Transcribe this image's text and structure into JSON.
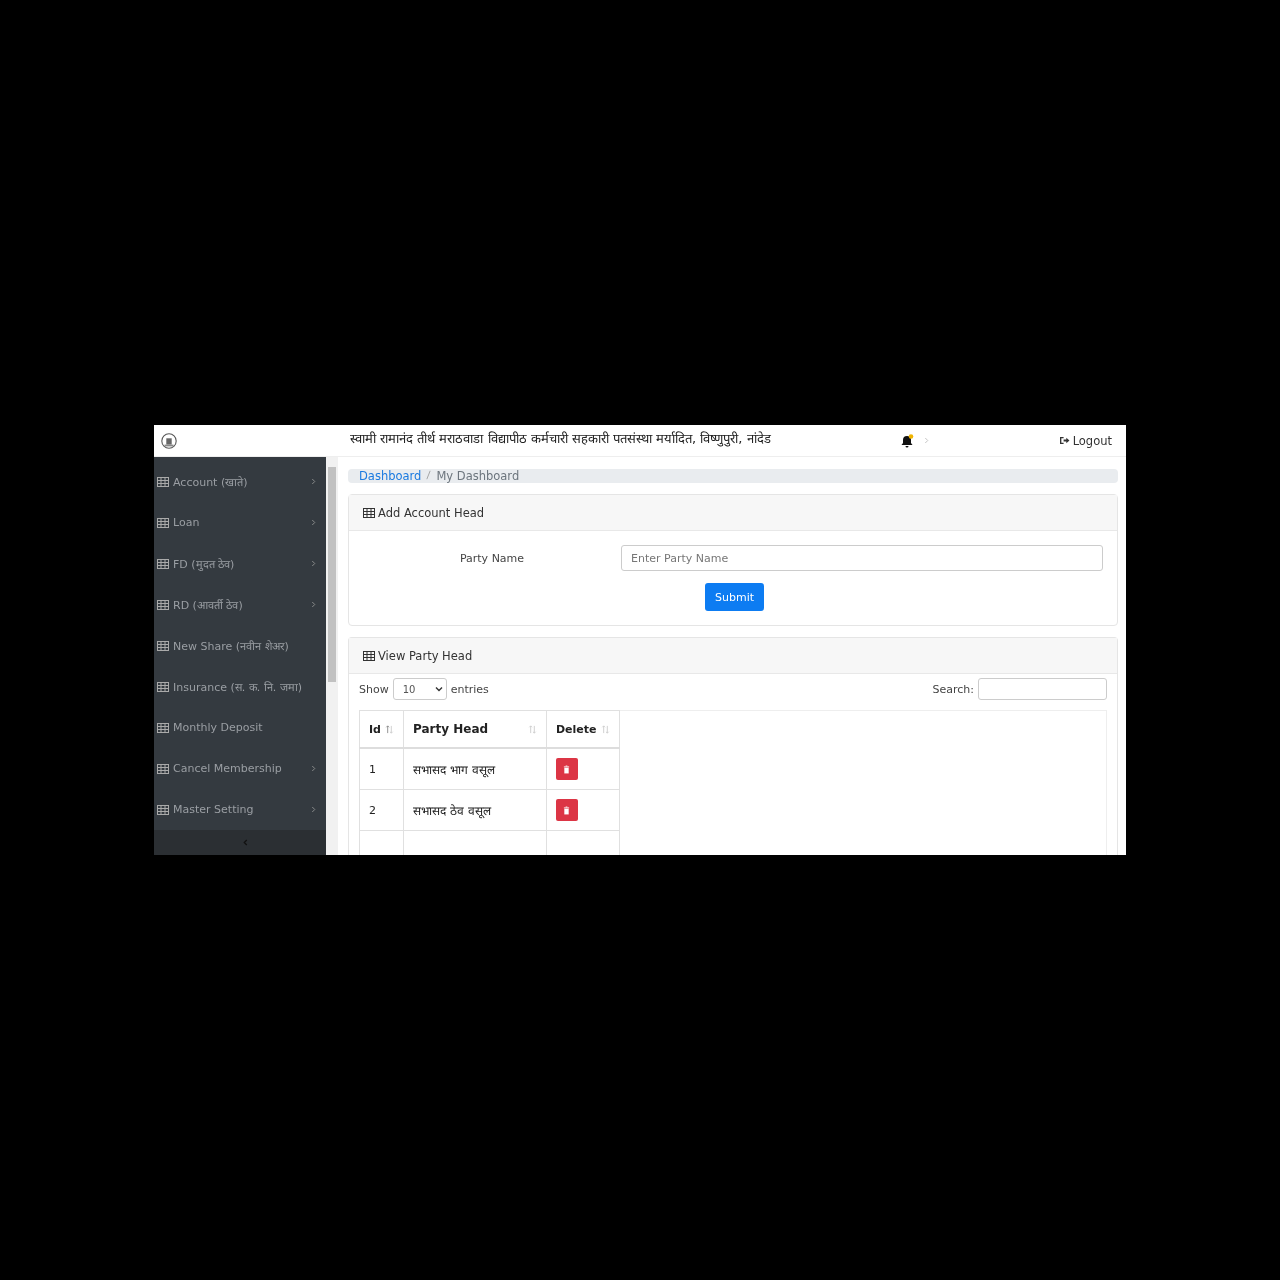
{
  "header": {
    "title": "स्वामी रामानंद तीर्थ मराठवाडा विद्यापीठ कर्मचारी सहकारी पतसंस्था मर्यादित, विष्णुपुरी, नांदेड",
    "notification_dot": true,
    "logout": "Logout"
  },
  "sidebar": {
    "items": [
      {
        "label": "Account (खाते)",
        "has_submenu": true
      },
      {
        "label": "Loan",
        "has_submenu": true
      },
      {
        "label": "FD (मुदत ठेव)",
        "has_submenu": true
      },
      {
        "label": "RD (आवर्ती ठेव)",
        "has_submenu": true
      },
      {
        "label": "New Share (नवीन शेअर)",
        "has_submenu": false
      },
      {
        "label": "Insurance (स. क. नि. जमा)",
        "has_submenu": false
      },
      {
        "label": "Monthly Deposit",
        "has_submenu": false
      },
      {
        "label": "Cancel Membership",
        "has_submenu": true
      },
      {
        "label": "Master Setting",
        "has_submenu": true
      }
    ]
  },
  "breadcrumb": [
    "Dashboard",
    "My Dashboard"
  ],
  "add_card": {
    "title": "Add Account Head",
    "field_label": "Party Name",
    "placeholder": "Enter Party Name",
    "submit": "Submit"
  },
  "view_card": {
    "title": "View Party Head",
    "show": "Show",
    "page_size": "10",
    "entries": "entries",
    "search_label": "Search:",
    "columns": [
      "Id",
      "Party Head",
      "Delete"
    ],
    "rows": [
      {
        "id": "1",
        "party_head": "सभासद भाग वसूल"
      },
      {
        "id": "2",
        "party_head": "सभासद ठेव वसूल"
      }
    ]
  }
}
